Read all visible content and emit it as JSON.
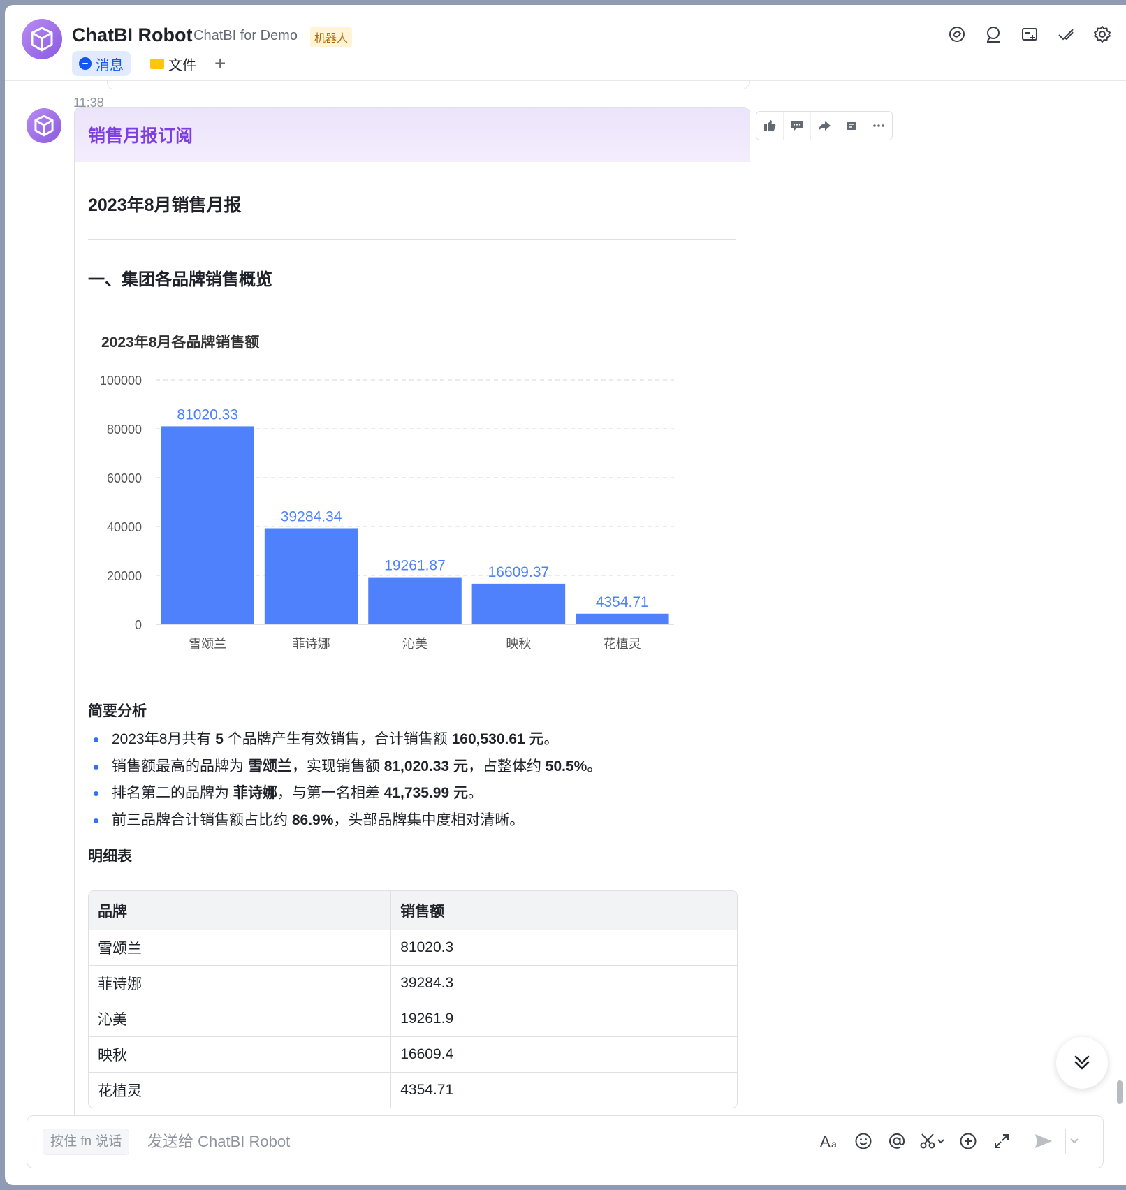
{
  "header": {
    "title": "ChatBI Robot",
    "subtitle": "ChatBI for Demo",
    "badge": "机器人",
    "tabs": [
      {
        "label": "消息",
        "icon": "chat-bubble-icon"
      },
      {
        "label": "文件",
        "icon": "folder-icon"
      }
    ],
    "add_tab": "+",
    "actions": [
      "chat-history-icon",
      "search-icon",
      "add-tab-icon",
      "task-done-icon",
      "settings-icon"
    ]
  },
  "message": {
    "time": "11:38",
    "card_title": "销售月报订阅",
    "report_title": "2023年8月销售月报",
    "section_title": "一、集团各品牌销售概览",
    "analysis_title": "简要分析",
    "analysis": [
      {
        "pre": "2023年8月共有 ",
        "b1": "5",
        "mid": " 个品牌产生有效销售，合计销售额 ",
        "b2": "160,530.61 元",
        "post": "。"
      },
      {
        "pre": "销售额最高的品牌为 ",
        "b1": "雪颂兰",
        "mid": "，实现销售额 ",
        "b2": "81,020.33 元",
        "mid2": "，占整体约 ",
        "b3": "50.5%",
        "post": "。"
      },
      {
        "pre": "排名第二的品牌为 ",
        "b1": "菲诗娜",
        "mid": "，与第一名相差 ",
        "b2": "41,735.99 元",
        "post": "。"
      },
      {
        "pre": "前三品牌合计销售额占比约 ",
        "b1": "86.9%",
        "mid": "，头部品牌集中度相对清晰。",
        "b2": "",
        "post": ""
      }
    ],
    "detail_title": "明细表",
    "table": {
      "headers": [
        "品牌",
        "销售额"
      ],
      "rows": [
        [
          "雪颂兰",
          "81020.3"
        ],
        [
          "菲诗娜",
          "39284.3"
        ],
        [
          "沁美",
          "19261.9"
        ],
        [
          "映秋",
          "16609.4"
        ],
        [
          "花植灵",
          "4354.71"
        ]
      ]
    },
    "actions": [
      "thumbs-up-icon",
      "comment-icon",
      "forward-icon",
      "quote-icon",
      "more-icon"
    ]
  },
  "composer": {
    "voice_hint": "按住 fn 说话",
    "placeholder": "发送给 ChatBI Robot",
    "tools": [
      "font-format-icon",
      "emoji-icon",
      "mention-icon",
      "scissors-icon",
      "add-icon",
      "expand-icon",
      "send-icon",
      "send-options-icon"
    ]
  },
  "colors": {
    "accent": "#1456f0",
    "bar": "#4e81fb",
    "card_title": "#7b3fe4",
    "badge_bg": "#fff4d6",
    "badge_text": "#b26a00"
  },
  "chart_data": {
    "type": "bar",
    "title": "2023年8月各品牌销售额",
    "categories": [
      "雪颂兰",
      "菲诗娜",
      "沁美",
      "映秋",
      "花植灵"
    ],
    "values": [
      81020.33,
      39284.34,
      19261.87,
      16609.37,
      4354.71
    ],
    "value_labels": [
      "81020.33",
      "39284.34",
      "19261.87",
      "16609.37",
      "4354.71"
    ],
    "ylim": [
      0,
      100000
    ],
    "yticks": [
      "0",
      "20000",
      "40000",
      "60000",
      "80000",
      "100000"
    ],
    "grid": true,
    "xlabel": "",
    "ylabel": ""
  }
}
